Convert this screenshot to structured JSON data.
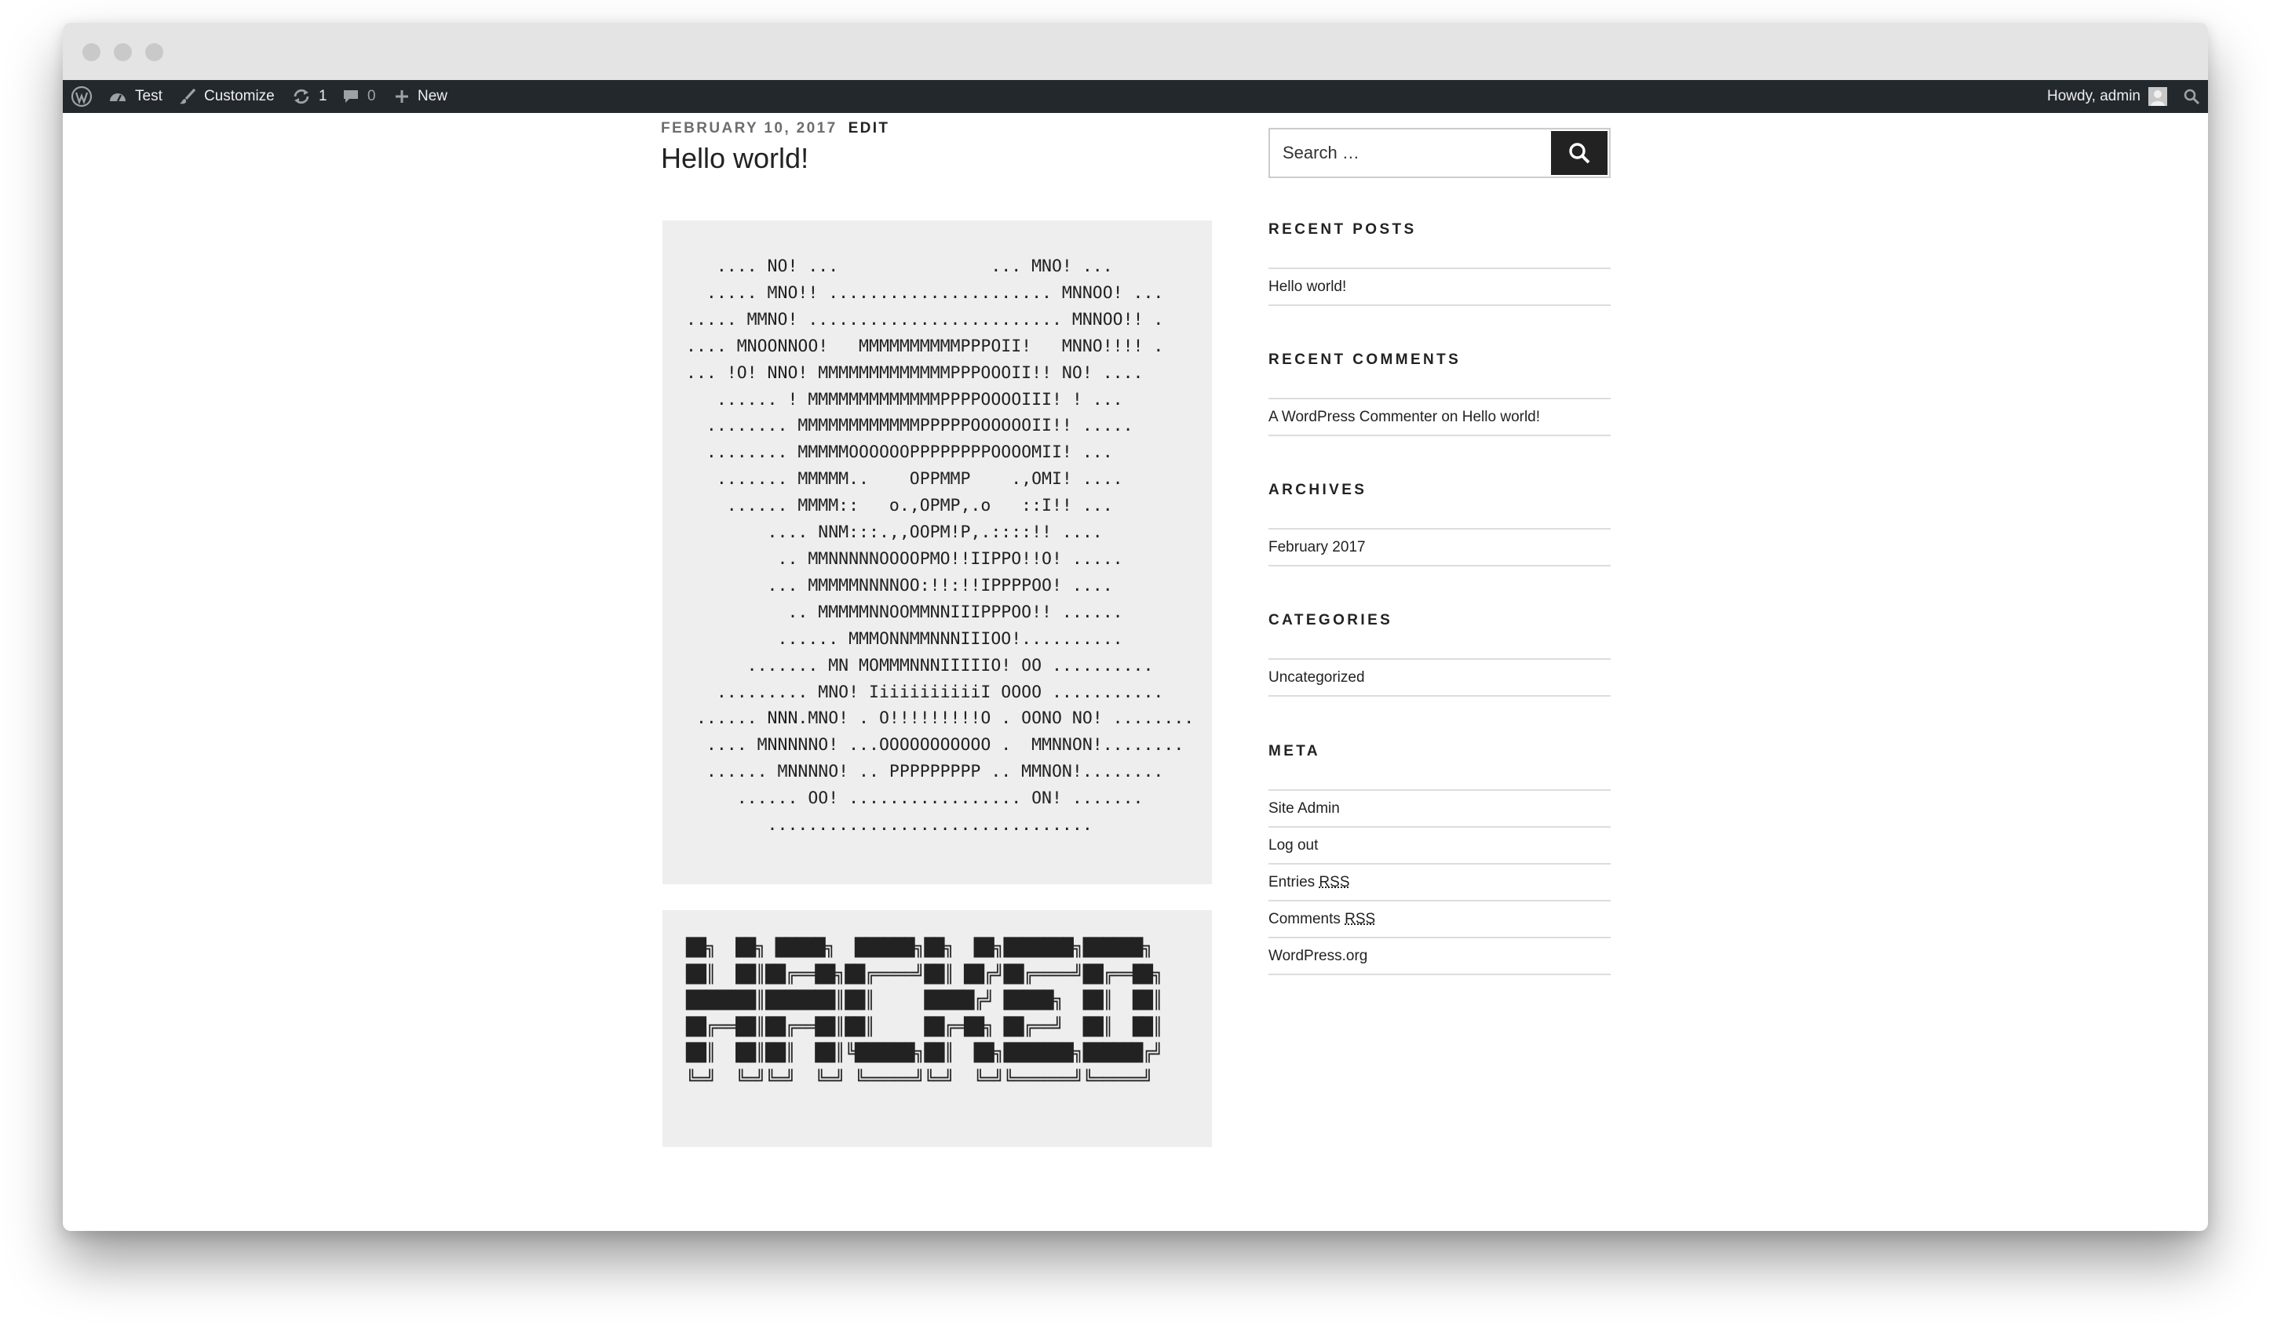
{
  "admin_bar": {
    "site_name": "Test",
    "customize": "Customize",
    "updates_count": "1",
    "comments_count": "0",
    "new_label": "New",
    "howdy": "Howdy, admin"
  },
  "post": {
    "date": "FEBRUARY 10, 2017",
    "edit": "EDIT",
    "title": "Hello world!",
    "ascii_art_1": "   .... NO! ...               ... MNO! ...\n  ..... MNO!! ...................... MNNOO! ...\n..... MMNO! ......................... MNNOO!! .\n.... MNOONNOO!   MMMMMMMMMMPPPOII!   MNNO!!!! .\n... !O! NNO! MMMMMMMMMMMMMPPPOOOII!! NO! ....\n   ...... ! MMMMMMMMMMMMMPPPPOOOOIII! ! ...\n  ........ MMMMMMMMMMMMPPPPPOOOOOOII!! .....\n  ........ MMMMMOOOOOOPPPPPPPPOOOOMII! ...\n   ....... MMMMM..    OPPMMP    .,OMI! ....\n    ...... MMMM::   o.,OPMP,.o   ::I!! ...\n        .... NNM:::.,,OOPM!P,.::::!! ....\n         .. MMNNNNNOOOOPMO!!IIPPO!!O! .....\n        ... MMMMMNNNNOO:!!:!!IPPPPOO! ....\n          .. MMMMMNNOOMMNNIIIPPPOO!! ......\n         ...... MMMONNMMNNNIIIOO!..........\n      ....... MN MOMMMNNNIIIIIO! OO ..........\n   ......... MNO! IiiiiiiiiiiI OOOO ...........\n ...... NNN.MNO! . O!!!!!!!!!O . OONO NO! ........\n  .... MNNNNNO! ...OOOOOOOOOOO .  MMNNON!........\n  ...... MNNNNO! .. PPPPPPPPP .. MMNON!........\n     ...... OO! ................. ON! .......\n        ................................",
    "ascii_art_2": "██╗  ██╗ █████╗  ██████╗██╗  ██╗███████╗██████╗\n██║  ██║██╔══██╗██╔════╝██║ ██╔╝██╔════╝██╔══██╗\n███████║███████║██║     █████╔╝ █████╗  ██║  ██║\n██╔══██║██╔══██║██║     ██╔═██╗ ██╔══╝  ██║  ██║\n██║  ██║██║  ██║╚██████╗██║  ██╗███████╗██████╔╝\n╚═╝  ╚═╝╚═╝  ╚═╝ ╚═════╝╚═╝  ╚═╝╚══════╝╚═════╝"
  },
  "sidebar": {
    "search_placeholder": "Search …",
    "recent_posts": {
      "title": "RECENT POSTS",
      "items": [
        "Hello world!"
      ]
    },
    "recent_comments": {
      "title": "RECENT COMMENTS",
      "author": "A WordPress Commenter",
      "on": "on",
      "post": "Hello world!"
    },
    "archives": {
      "title": "ARCHIVES",
      "items": [
        "February 2017"
      ]
    },
    "categories": {
      "title": "CATEGORIES",
      "items": [
        "Uncategorized"
      ]
    },
    "meta": {
      "title": "META",
      "site_admin": "Site Admin",
      "log_out": "Log out",
      "entries": "Entries",
      "comments": "Comments",
      "rss": "RSS",
      "wordpress_org": "WordPress.org"
    }
  },
  "colors": {
    "admin_bar_bg": "#23282d",
    "pre_bg": "#eeeeee",
    "search_button_bg": "#222222"
  }
}
